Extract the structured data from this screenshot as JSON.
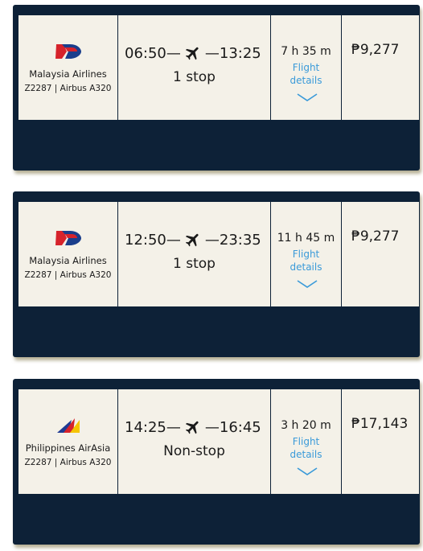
{
  "flights": [
    {
      "airline": "Malaysia Airlines",
      "flight_no": "Z2287 | Airbus A320",
      "logo_icon": "malaysia-airlines-logo",
      "depart": "06:50",
      "arrive": "13:25",
      "stops": "1 stop",
      "duration": "7 h 35 m",
      "details_line1": "Flight",
      "details_line2": "details",
      "price": "₱9,277"
    },
    {
      "airline": "Malaysia Airlines",
      "flight_no": "Z2287 | Airbus A320",
      "logo_icon": "malaysia-airlines-logo",
      "depart": "12:50",
      "arrive": "23:35",
      "stops": "1 stop",
      "duration": "11 h 45 m",
      "details_line1": "Flight",
      "details_line2": "details",
      "price": "₱9,277"
    },
    {
      "airline": "Philippines AirAsia",
      "flight_no": "Z2287 | Airbus A320",
      "logo_icon": "philippine-airlines-logo",
      "depart": "14:25",
      "arrive": "16:45",
      "stops": "Non-stop",
      "duration": "3 h 20 m",
      "details_line1": "Flight",
      "details_line2": "details",
      "price": "₱17,143"
    }
  ],
  "colors": {
    "card_bg": "#0d2137",
    "panel_bg": "#f4f1e8",
    "link": "#3a9ad9"
  }
}
